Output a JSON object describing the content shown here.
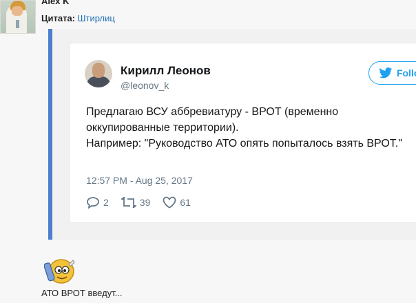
{
  "post": {
    "author": "Alex K",
    "quote_label": "Цитата:",
    "quote_source": "Штирлиц"
  },
  "tweet": {
    "name": "Кирилл Леонов",
    "handle": "@leonov_k",
    "follow_label": "Follow",
    "text_line1": "Предлагаю ВСУ аббревиатуру - ВРОТ (временно оккупированные территории).",
    "text_line2": "Например: \"Руководство АТО опять попыталось взять ВРОТ.\"",
    "timestamp": "12:57 PM - Aug 25, 2017",
    "replies": "2",
    "retweets": "39",
    "likes": "61"
  },
  "footer": {
    "text": "АТО ВРОТ введут..."
  },
  "colors": {
    "quote_border": "#4d7fcf",
    "link": "#1e6fb5",
    "twitter_blue": "#1da1f2",
    "muted": "#657786"
  },
  "icons": [
    "user-avatar-icon",
    "twitter-bird-icon",
    "reply-icon",
    "retweet-icon",
    "like-icon",
    "smiley-icon"
  ]
}
